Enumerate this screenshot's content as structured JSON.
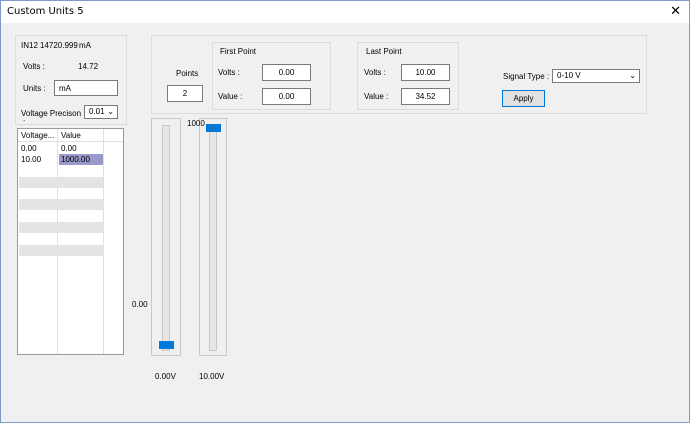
{
  "window": {
    "title": "Custom Units 5",
    "close": "✕"
  },
  "info": {
    "input": "IN12",
    "reading": "14720.999",
    "reading_unit": "mA",
    "volts_label": "Volts :",
    "volts_value": "14.72",
    "units_label": "Units :",
    "units_value": "mA",
    "precision_label": "Voltage Precison",
    "precision_dot": ".",
    "precision_value": "0.01"
  },
  "table": {
    "columns": [
      "Voltage...",
      "Value"
    ],
    "rows": [
      [
        "0.00",
        "0.00"
      ],
      [
        "10.00",
        "1000.00"
      ]
    ]
  },
  "points": {
    "label": "Points",
    "value": "2"
  },
  "first_point": {
    "title": "First Point",
    "volts_label": "Volts :",
    "volts_value": "0.00",
    "value_label": "Value :",
    "value_value": "0.00"
  },
  "last_point": {
    "title": "Last Point",
    "volts_label": "Volts :",
    "volts_value": "10.00",
    "value_label": "Value :",
    "value_value": "34.52"
  },
  "signal": {
    "label": "Signal Type :",
    "value": "0-10 V",
    "apply_label": "Apply"
  },
  "sliders": {
    "left_value_label": "0.00",
    "left_volts_label": "0.00V",
    "right_value_label": "1000",
    "right_volts_label": "10.00V",
    "left_level": 0,
    "right_level": 1
  },
  "colors": {
    "accent": "#0078d7",
    "selection": "#9999cc",
    "window_bg": "#f0f0f0"
  }
}
